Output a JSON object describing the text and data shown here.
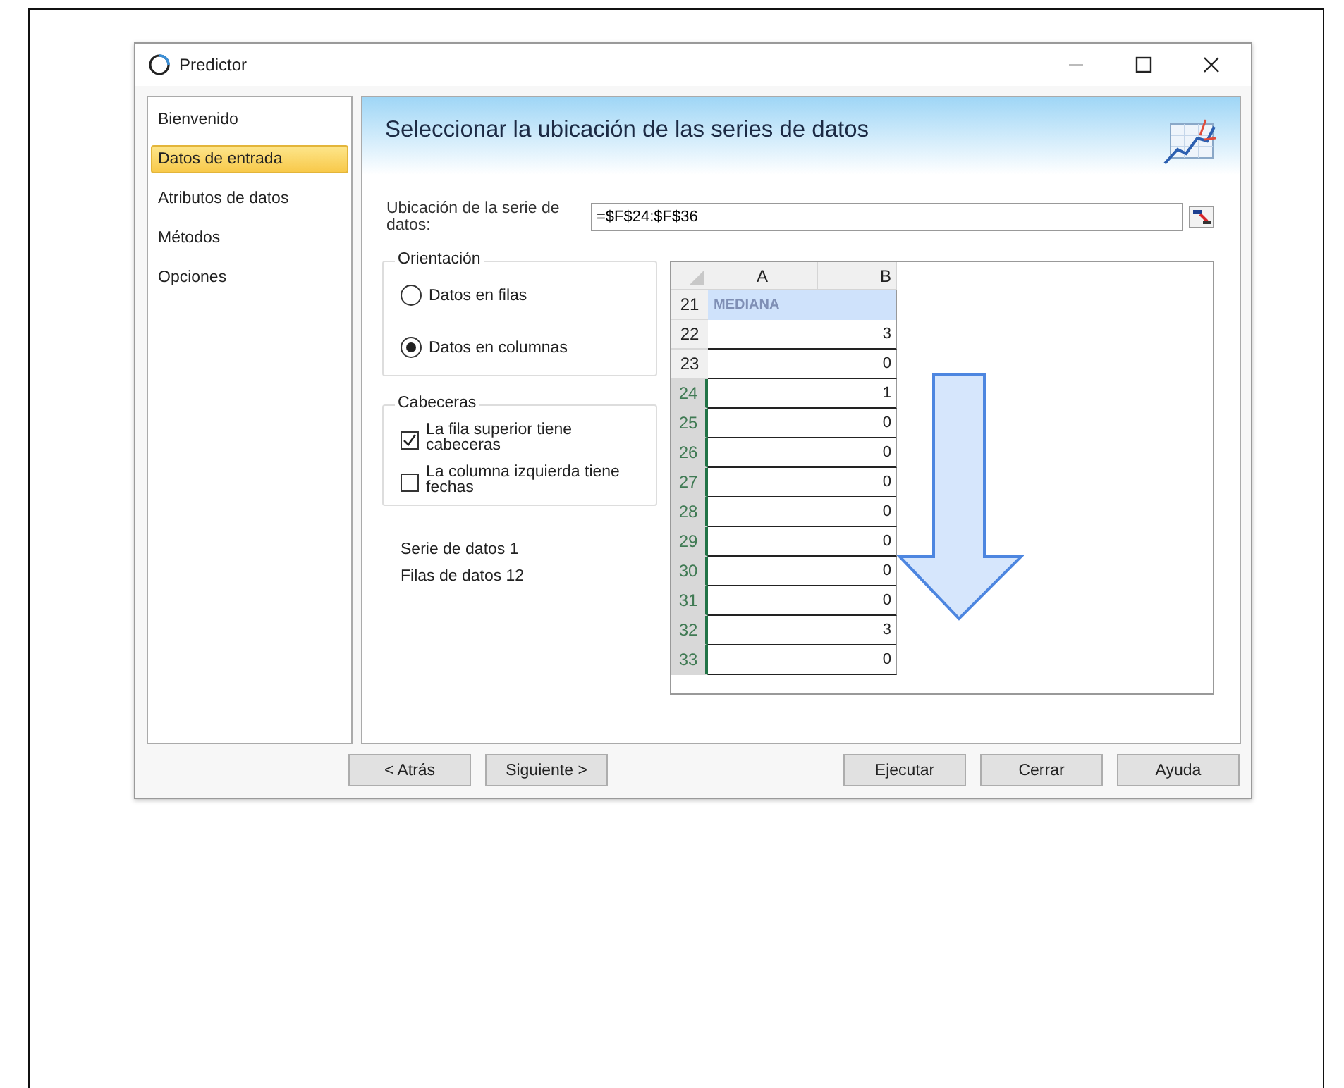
{
  "window": {
    "title": "Predictor"
  },
  "sidebar": {
    "items": [
      {
        "label": "Bienvenido",
        "selected": false
      },
      {
        "label": "Datos de entrada",
        "selected": true
      },
      {
        "label": "Atributos de datos",
        "selected": false
      },
      {
        "label": "Métodos",
        "selected": false
      },
      {
        "label": "Opciones",
        "selected": false
      }
    ]
  },
  "header": {
    "title": "Seleccionar la ubicación de las series de datos"
  },
  "location": {
    "label": "Ubicación de la serie de datos:",
    "value": "=$F$24:$F$36"
  },
  "orientation": {
    "legend": "Orientación",
    "options": [
      {
        "label": "Datos en filas",
        "selected": false
      },
      {
        "label": "Datos en columnas",
        "selected": true
      }
    ]
  },
  "headers": {
    "legend": "Cabeceras",
    "options": [
      {
        "label": "La fila superior tiene cabeceras",
        "checked": true
      },
      {
        "label": "La columna izquierda tiene fechas",
        "checked": false
      }
    ]
  },
  "stats": [
    "Serie de datos 1",
    "Filas de datos 12"
  ],
  "sheet": {
    "columns": [
      "A",
      "B"
    ],
    "rows": [
      {
        "number": "21",
        "a": "MEDIANA",
        "selected": false,
        "highlighted": true
      },
      {
        "number": "22",
        "b": "3",
        "selected": false,
        "highlighted": false
      },
      {
        "number": "23",
        "b": "0",
        "selected": false,
        "highlighted": false
      },
      {
        "number": "24",
        "b": "1",
        "selected": true,
        "highlighted": false
      },
      {
        "number": "25",
        "b": "0",
        "selected": true,
        "highlighted": false
      },
      {
        "number": "26",
        "b": "0",
        "selected": true,
        "highlighted": false
      },
      {
        "number": "27",
        "b": "0",
        "selected": true,
        "highlighted": false
      },
      {
        "number": "28",
        "b": "0",
        "selected": true,
        "highlighted": false
      },
      {
        "number": "29",
        "b": "0",
        "selected": true,
        "highlighted": false
      },
      {
        "number": "30",
        "b": "0",
        "selected": true,
        "highlighted": false
      },
      {
        "number": "31",
        "b": "0",
        "selected": true,
        "highlighted": false
      },
      {
        "number": "32",
        "b": "3",
        "selected": true,
        "highlighted": false
      },
      {
        "number": "33",
        "b": "0",
        "selected": true,
        "highlighted": false
      }
    ]
  },
  "buttons": {
    "left": [
      "< Atrás",
      "Siguiente >"
    ],
    "right": [
      "Ejecutar",
      "Cerrar",
      "Ayuda"
    ]
  }
}
